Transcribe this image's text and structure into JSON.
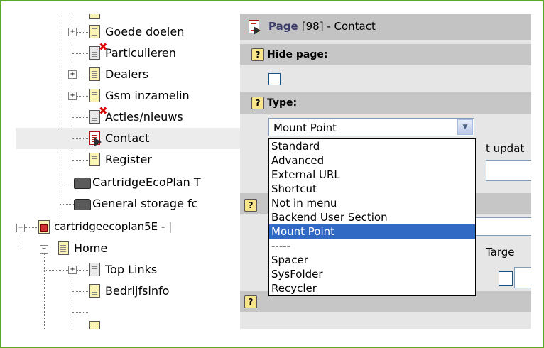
{
  "tree": {
    "items": [
      {
        "label": "Goede doelen"
      },
      {
        "label": "Particulieren"
      },
      {
        "label": "Dealers"
      },
      {
        "label": "Gsm inzamelin"
      },
      {
        "label": "Acties/nieuws"
      },
      {
        "label": "Contact"
      },
      {
        "label": "Register"
      },
      {
        "label": "CartridgeEcoPlan T"
      },
      {
        "label": "General storage fc"
      },
      {
        "label": "cartridgeecoplan5E - |"
      },
      {
        "label": "Home"
      },
      {
        "label": "Top Links"
      },
      {
        "label": "Bedrijfsinfo"
      }
    ]
  },
  "page_header": {
    "prefix": "Page",
    "id_and_title": " [98] - Contact"
  },
  "fields": {
    "hide_page_label": "Hide page:",
    "type_label": "Type:",
    "type_selected": "Mount Point",
    "help_glyph": "?"
  },
  "type_options": [
    "Standard",
    "Advanced",
    "External URL",
    "Shortcut",
    "Not in menu",
    "Backend User Section",
    "Mount Point",
    "-----",
    "Spacer",
    "SysFolder",
    "Recycler"
  ],
  "partial_labels": {
    "last_update_partial": "t updat",
    "target_partial": "Targe"
  },
  "colors": {
    "frame_border": "#5ea825",
    "highlight": "#316ac5",
    "panel_bg": "#e6e6e6",
    "header_bg": "#c6c6c6"
  }
}
